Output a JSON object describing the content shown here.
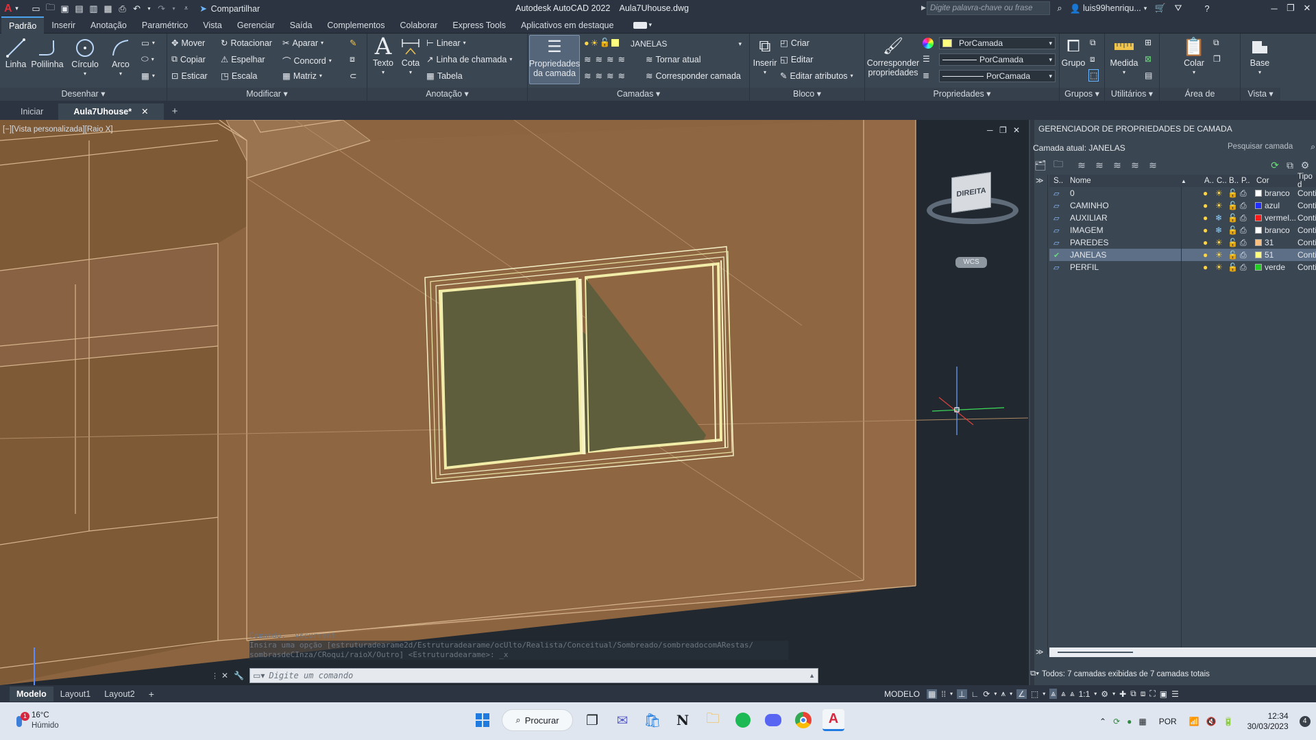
{
  "title": {
    "app": "Autodesk AutoCAD 2022",
    "file": "Aula7Uhouse.dwg",
    "share": "Compartilhar",
    "search_placeholder": "Digite palavra-chave ou frase",
    "user": "luis99henriqu..."
  },
  "menu": [
    "Padrão",
    "Inserir",
    "Anotação",
    "Paramétrico",
    "Vista",
    "Gerenciar",
    "Saída",
    "Complementos",
    "Colaborar",
    "Express Tools",
    "Aplicativos em destaque"
  ],
  "ribbon": {
    "desenhar": {
      "title": "Desenhar ▾",
      "linha": "Linha",
      "polilinha": "Polilinha",
      "circulo": "Círculo",
      "arco": "Arco"
    },
    "modificar": {
      "title": "Modificar ▾",
      "mover": "Mover",
      "rotacionar": "Rotacionar",
      "aparar": "Aparar",
      "copiar": "Copiar",
      "espelhar": "Espelhar",
      "concord": "Concord",
      "esticar": "Esticar",
      "escala": "Escala",
      "matriz": "Matriz"
    },
    "anotacao": {
      "title": "Anotação ▾",
      "texto": "Texto",
      "cota": "Cota",
      "linear": "Linear",
      "linha_chamada": "Linha de chamada",
      "tabela": "Tabela"
    },
    "camadas": {
      "title": "Camadas ▾",
      "propriedades": "Propriedades da camada",
      "current_layer": "JANELAS",
      "tornar_atual": "Tornar atual",
      "corresponder_camada": "Corresponder camada"
    },
    "bloco": {
      "title": "Bloco ▾",
      "inserir": "Inserir",
      "criar": "Criar",
      "editar": "Editar",
      "editar_atributos": "Editar atributos"
    },
    "propriedades": {
      "title": "Propriedades ▾",
      "corresponder": "Corresponder propriedades",
      "color": "PorCamada",
      "linetype": "PorCamada",
      "lineweight": "PorCamada"
    },
    "grupos": {
      "title": "Grupos ▾",
      "grupo": "Grupo"
    },
    "utilitarios": {
      "title": "Utilitários ▾",
      "medida": "Medida"
    },
    "transferencia": {
      "title": "Área de transferência",
      "colar": "Colar"
    },
    "vista": {
      "title": "Vista ▾",
      "base": "Base"
    }
  },
  "doc_tabs": {
    "iniciar": "Iniciar",
    "active": "Aula7Uhouse*"
  },
  "viewport": {
    "label": "[−][Vista personalizada][Raio X]",
    "viewcube_face": "DIREITA",
    "wcs": "WCS",
    "cmd_history_1": "Comando: _vscurrent",
    "cmd_history_2": "Insira uma opção [estruturadearame2d/Estruturadearame/ocUlto/Realista/Conceitual/Sombreado/sombreadocomARestas/",
    "cmd_history_3": "sombrasdeCInza/CRoqui/raioX/Outro] <Estruturadearame>: _x",
    "cmd_placeholder": "Digite um comando"
  },
  "palette": {
    "title": "GERENCIADOR DE PROPRIEDADES DE CAMADA",
    "current": "Camada atual: JANELAS",
    "search": "Pesquisar camada",
    "col_s": "S..",
    "col_name": "Nome",
    "col_a": "A..",
    "col_c": "C..",
    "col_b": "B..",
    "col_p": "P..",
    "col_color": "Cor",
    "col_type": "Tipo d",
    "layers": [
      {
        "name": "0",
        "color_name": "branco",
        "color": "#ffffff",
        "type": "Conti",
        "freeze": "☀"
      },
      {
        "name": "CAMINHO",
        "color_name": "azul",
        "color": "#1f2dff",
        "type": "Conti",
        "freeze": "☀"
      },
      {
        "name": "AUXILIAR",
        "color_name": "vermel...",
        "color": "#ff1a1a",
        "type": "Conti",
        "freeze": "❄"
      },
      {
        "name": "IMAGEM",
        "color_name": "branco",
        "color": "#ffffff",
        "type": "Conti",
        "freeze": "❄"
      },
      {
        "name": "PAREDES",
        "color_name": "31",
        "color": "#ffbf7f",
        "type": "Conti",
        "freeze": "☀"
      },
      {
        "name": "JANELAS",
        "color_name": "51",
        "color": "#ffff7f",
        "type": "Conti",
        "freeze": "☀"
      },
      {
        "name": "PERFIL",
        "color_name": "verde",
        "color": "#22cc22",
        "type": "Conti",
        "freeze": "☀"
      }
    ],
    "status": "Todos: 7 camadas exibidas de 7 camadas totais"
  },
  "layout_tabs": [
    "Modelo",
    "Layout1",
    "Layout2"
  ],
  "statusbar": {
    "modelo": "MODELO",
    "scale": "1:1"
  },
  "taskbar": {
    "temp": "16°C",
    "weather": "Húmido",
    "badge": "1",
    "search": "Procurar",
    "lang": "POR",
    "time": "12:34",
    "date": "30/03/2023",
    "notif": "4"
  }
}
